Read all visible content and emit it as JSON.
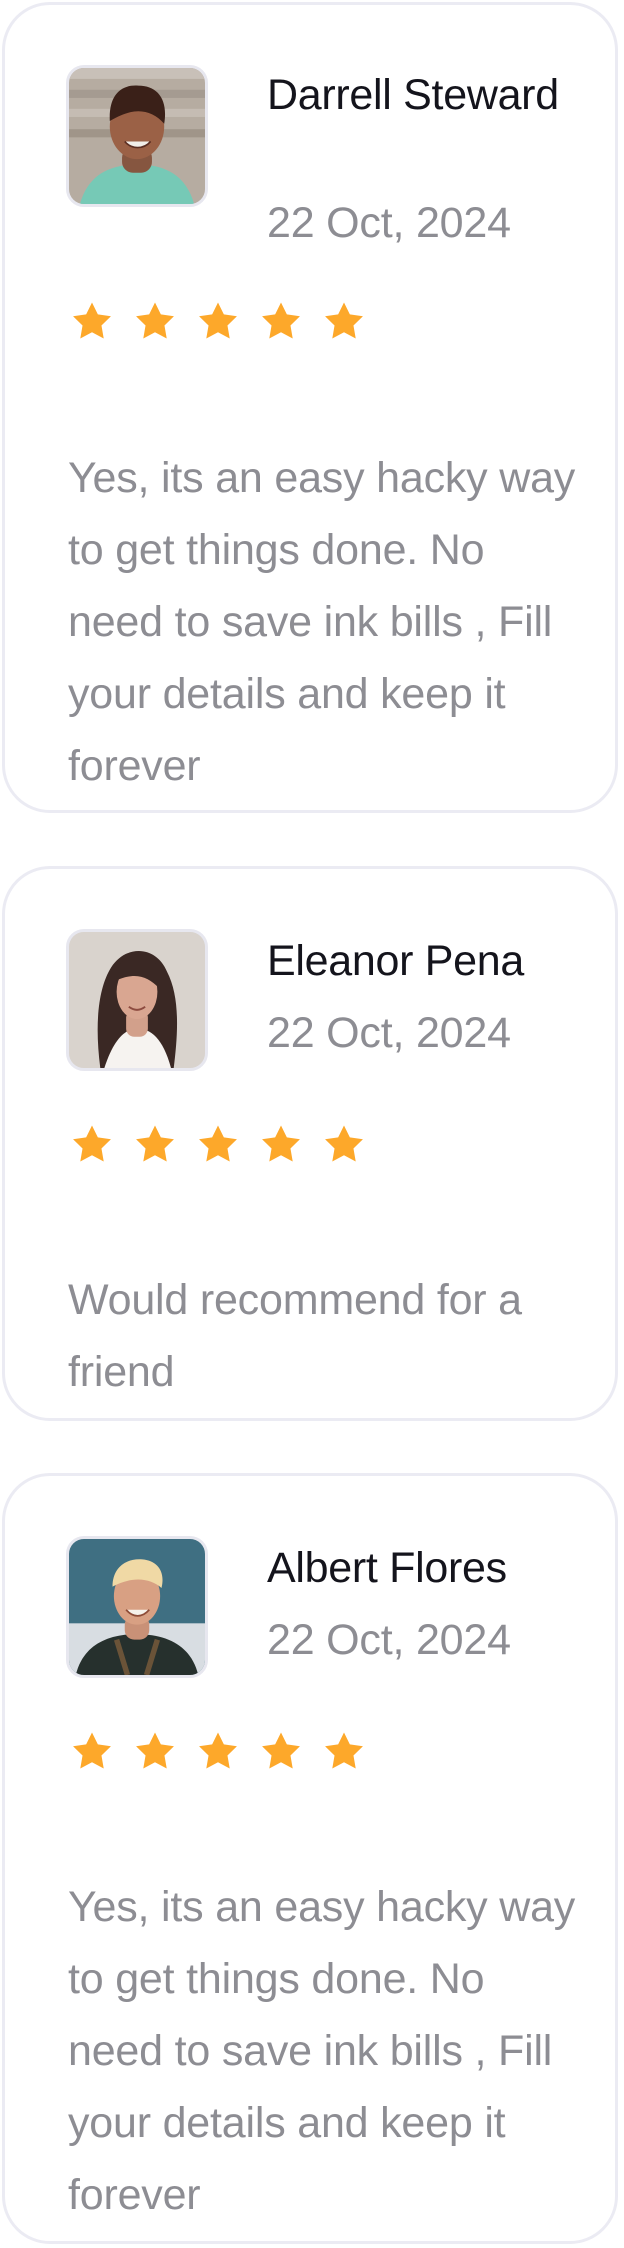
{
  "reviews": [
    {
      "name": "Darrell Steward",
      "date": "22 Oct, 2024",
      "rating": 5,
      "text": "Yes, its an easy hacky way to get things done. No need to save ink bills , Fill your details and keep it forever",
      "avatar_icon": "avatar-photo"
    },
    {
      "name": "Eleanor Pena",
      "date": "22 Oct, 2024",
      "rating": 5,
      "text": "Would recommend for a friend",
      "avatar_icon": "avatar-photo"
    },
    {
      "name": "Albert Flores",
      "date": "22 Oct, 2024",
      "rating": 5,
      "text": "Yes, its an easy hacky way to get things done. No need to save ink bills , Fill your details and keep it forever",
      "avatar_icon": "avatar-photo"
    }
  ],
  "colors": {
    "star": "#fda82a",
    "name": "#14141c",
    "muted": "#8d8d93",
    "card_border": "#ebebf3"
  }
}
